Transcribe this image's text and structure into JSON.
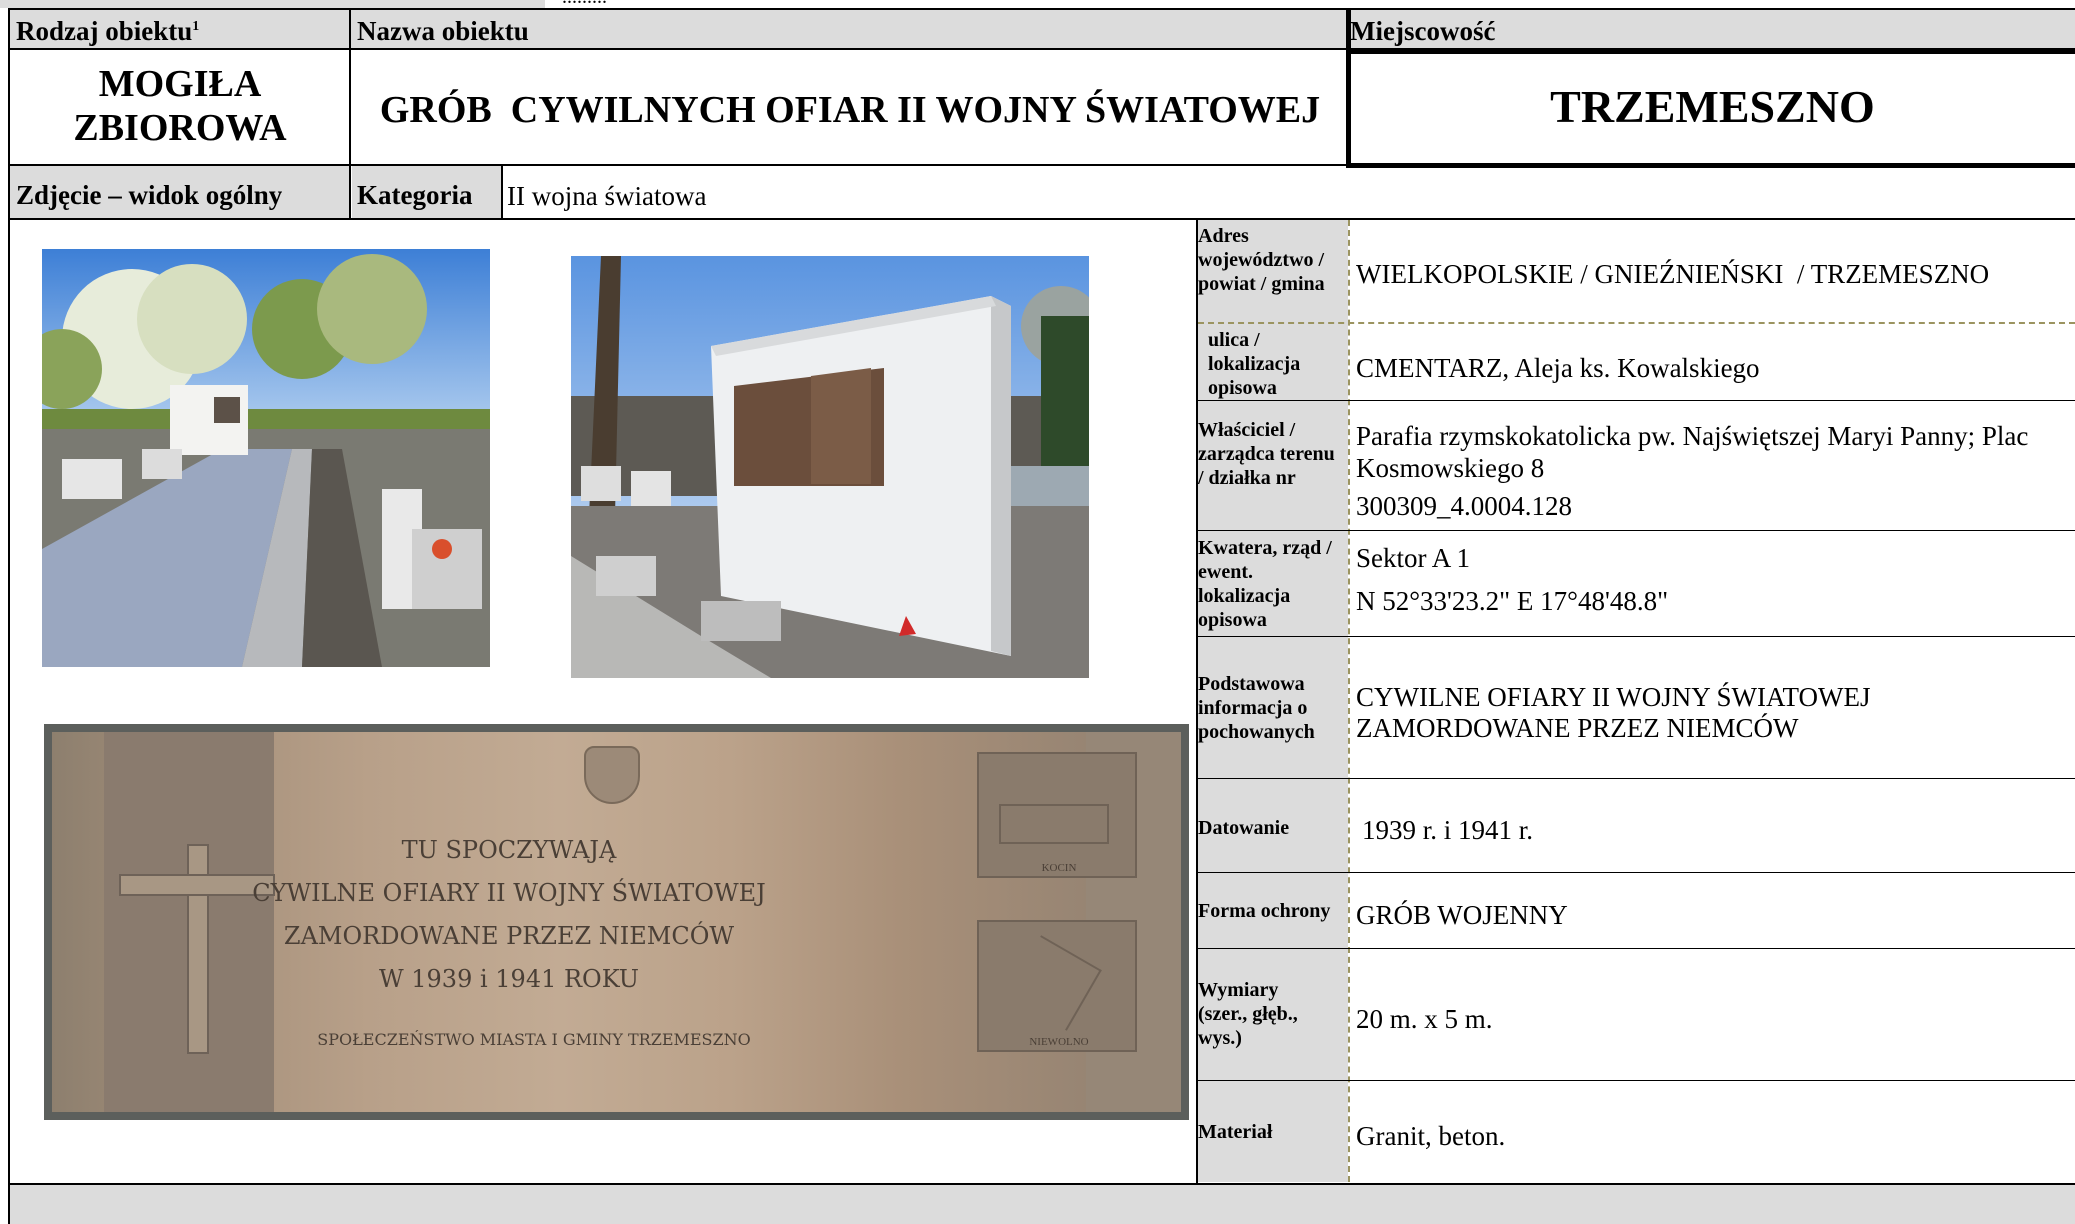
{
  "header": {
    "top_dots": ".........",
    "col1_label": "Rodzaj obiektu",
    "col1_sup": "1",
    "col2_label": "Nazwa obiektu",
    "col3_label": "Miejscowość"
  },
  "object": {
    "type_line1": "MOGIŁA",
    "type_line2": "ZBIOROWA",
    "name": "GRÓB  CYWILNYCH OFIAR II WOJNY ŚWIATOWEJ",
    "town": "TRZEMESZNO"
  },
  "row2": {
    "photo_label": "Zdjęcie – widok ogólny",
    "category_label": "Kategoria",
    "category_value": "II wojna światowa"
  },
  "plaque": {
    "line1": "TU SPOCZYWAJĄ",
    "line2": "CYWILNE OFIARY II WOJNY ŚWIATOWEJ",
    "line3": "ZAMORDOWANE PRZEZ NIEMCÓW",
    "line4": "W 1939 i 1941 ROKU",
    "line5": "SPOŁECZEŃSTWO MIASTA I GMINY TRZEMESZNO",
    "panel1": "KOCIN",
    "panel2": "NIEWOLNO"
  },
  "details": {
    "address_label": "Adres województwo / powiat / gmina",
    "address_value": "WIELKOPOLSKIE / GNIEŹNIEŃSKI  / TRZEMESZNO",
    "street_label": "ulica / lokalizacja opisowa",
    "street_value": "CMENTARZ, Aleja ks. Kowalskiego",
    "owner_label": "Właściciel / zarządca terenu / działka nr",
    "owner_value": "Parafia rzymskokatolicka pw. Najświętszej Maryi Panny; Plac Kosmowskiego 8",
    "owner_parcel": "300309_4.0004.128",
    "quarter_label": "Kwatera, rząd / ewent. lokalizacja opisowa",
    "quarter_value": "Sektor A 1",
    "quarter_coords": "N 52°33'23.2\" E 17°48'48.8\"",
    "basic_label": "Podstawowa informacja o pochowanych",
    "basic_value1": "CYWILNE OFIARY II WOJNY ŚWIATOWEJ",
    "basic_value2": "ZAMORDOWANE PRZEZ NIEMCÓW",
    "dating_label": "Datowanie",
    "dating_value": "1939 r. i 1941 r.",
    "protection_label": "Forma ochrony",
    "protection_value": "GRÓB WOJENNY",
    "dims_label": "Wymiary (szer., głęb., wys.)",
    "dims_value": "20 m. x 5 m.",
    "material_label": "Materiał",
    "material_value": "Granit, beton."
  }
}
